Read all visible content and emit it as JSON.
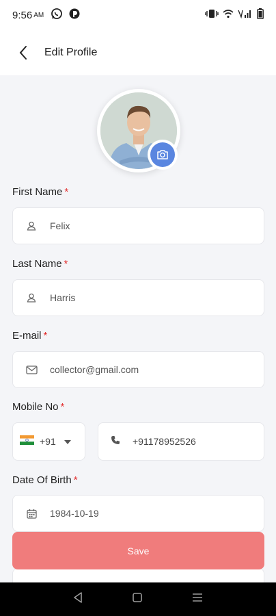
{
  "status_bar": {
    "time": "9:56",
    "ampm": "AM",
    "icons": [
      "whatsapp-icon",
      "app-icon",
      "vibrate-icon",
      "wifi-icon",
      "signal-icon",
      "battery-icon"
    ]
  },
  "header": {
    "title": "Edit Profile"
  },
  "profile": {
    "avatar_icon": "person-photo",
    "camera_icon": "camera-icon",
    "accent": "#5a86e0"
  },
  "form": {
    "first_name": {
      "label": "First Name",
      "required": "*",
      "value": "Felix"
    },
    "last_name": {
      "label": "Last Name",
      "required": "*",
      "value": "Harris"
    },
    "email": {
      "label": "E-mail",
      "required": "*",
      "value": "collector@gmail.com"
    },
    "mobile": {
      "label": "Mobile No",
      "required": "*",
      "country_code": "+91",
      "value": "+91178952526"
    },
    "dob": {
      "label": "Date Of Birth",
      "required": "*",
      "value": "1984-10-19"
    }
  },
  "actions": {
    "save_label": "Save",
    "save_color": "#f07c7c"
  },
  "colors": {
    "required": "#e22b2b",
    "background": "#f4f5f8"
  }
}
